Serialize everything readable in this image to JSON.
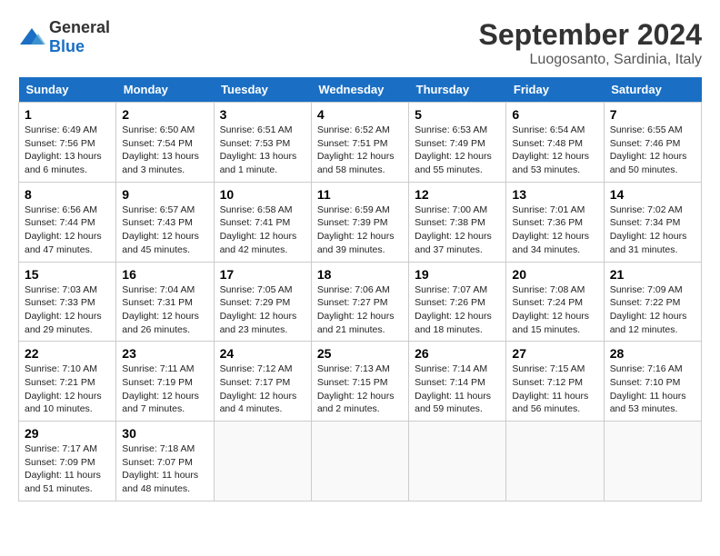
{
  "logo": {
    "general": "General",
    "blue": "Blue"
  },
  "header": {
    "month": "September 2024",
    "location": "Luogosanto, Sardinia, Italy"
  },
  "days": [
    "Sunday",
    "Monday",
    "Tuesday",
    "Wednesday",
    "Thursday",
    "Friday",
    "Saturday"
  ],
  "weeks": [
    [
      {
        "date": "1",
        "sunrise": "6:49 AM",
        "sunset": "7:56 PM",
        "daylight": "13 hours and 6 minutes."
      },
      {
        "date": "2",
        "sunrise": "6:50 AM",
        "sunset": "7:54 PM",
        "daylight": "13 hours and 3 minutes."
      },
      {
        "date": "3",
        "sunrise": "6:51 AM",
        "sunset": "7:53 PM",
        "daylight": "13 hours and 1 minute."
      },
      {
        "date": "4",
        "sunrise": "6:52 AM",
        "sunset": "7:51 PM",
        "daylight": "12 hours and 58 minutes."
      },
      {
        "date": "5",
        "sunrise": "6:53 AM",
        "sunset": "7:49 PM",
        "daylight": "12 hours and 55 minutes."
      },
      {
        "date": "6",
        "sunrise": "6:54 AM",
        "sunset": "7:48 PM",
        "daylight": "12 hours and 53 minutes."
      },
      {
        "date": "7",
        "sunrise": "6:55 AM",
        "sunset": "7:46 PM",
        "daylight": "12 hours and 50 minutes."
      }
    ],
    [
      {
        "date": "8",
        "sunrise": "6:56 AM",
        "sunset": "7:44 PM",
        "daylight": "12 hours and 47 minutes."
      },
      {
        "date": "9",
        "sunrise": "6:57 AM",
        "sunset": "7:43 PM",
        "daylight": "12 hours and 45 minutes."
      },
      {
        "date": "10",
        "sunrise": "6:58 AM",
        "sunset": "7:41 PM",
        "daylight": "12 hours and 42 minutes."
      },
      {
        "date": "11",
        "sunrise": "6:59 AM",
        "sunset": "7:39 PM",
        "daylight": "12 hours and 39 minutes."
      },
      {
        "date": "12",
        "sunrise": "7:00 AM",
        "sunset": "7:38 PM",
        "daylight": "12 hours and 37 minutes."
      },
      {
        "date": "13",
        "sunrise": "7:01 AM",
        "sunset": "7:36 PM",
        "daylight": "12 hours and 34 minutes."
      },
      {
        "date": "14",
        "sunrise": "7:02 AM",
        "sunset": "7:34 PM",
        "daylight": "12 hours and 31 minutes."
      }
    ],
    [
      {
        "date": "15",
        "sunrise": "7:03 AM",
        "sunset": "7:33 PM",
        "daylight": "12 hours and 29 minutes."
      },
      {
        "date": "16",
        "sunrise": "7:04 AM",
        "sunset": "7:31 PM",
        "daylight": "12 hours and 26 minutes."
      },
      {
        "date": "17",
        "sunrise": "7:05 AM",
        "sunset": "7:29 PM",
        "daylight": "12 hours and 23 minutes."
      },
      {
        "date": "18",
        "sunrise": "7:06 AM",
        "sunset": "7:27 PM",
        "daylight": "12 hours and 21 minutes."
      },
      {
        "date": "19",
        "sunrise": "7:07 AM",
        "sunset": "7:26 PM",
        "daylight": "12 hours and 18 minutes."
      },
      {
        "date": "20",
        "sunrise": "7:08 AM",
        "sunset": "7:24 PM",
        "daylight": "12 hours and 15 minutes."
      },
      {
        "date": "21",
        "sunrise": "7:09 AM",
        "sunset": "7:22 PM",
        "daylight": "12 hours and 12 minutes."
      }
    ],
    [
      {
        "date": "22",
        "sunrise": "7:10 AM",
        "sunset": "7:21 PM",
        "daylight": "12 hours and 10 minutes."
      },
      {
        "date": "23",
        "sunrise": "7:11 AM",
        "sunset": "7:19 PM",
        "daylight": "12 hours and 7 minutes."
      },
      {
        "date": "24",
        "sunrise": "7:12 AM",
        "sunset": "7:17 PM",
        "daylight": "12 hours and 4 minutes."
      },
      {
        "date": "25",
        "sunrise": "7:13 AM",
        "sunset": "7:15 PM",
        "daylight": "12 hours and 2 minutes."
      },
      {
        "date": "26",
        "sunrise": "7:14 AM",
        "sunset": "7:14 PM",
        "daylight": "11 hours and 59 minutes."
      },
      {
        "date": "27",
        "sunrise": "7:15 AM",
        "sunset": "7:12 PM",
        "daylight": "11 hours and 56 minutes."
      },
      {
        "date": "28",
        "sunrise": "7:16 AM",
        "sunset": "7:10 PM",
        "daylight": "11 hours and 53 minutes."
      }
    ],
    [
      {
        "date": "29",
        "sunrise": "7:17 AM",
        "sunset": "7:09 PM",
        "daylight": "11 hours and 51 minutes."
      },
      {
        "date": "30",
        "sunrise": "7:18 AM",
        "sunset": "7:07 PM",
        "daylight": "11 hours and 48 minutes."
      },
      null,
      null,
      null,
      null,
      null
    ]
  ]
}
